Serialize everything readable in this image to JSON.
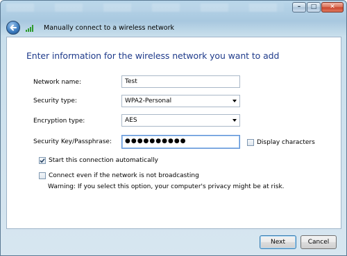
{
  "window": {
    "controls": {
      "minimize": "–",
      "maximize": "□",
      "close": "✕"
    }
  },
  "nav": {
    "title": "Manually connect to a wireless network",
    "back_icon": "back-arrow-icon",
    "network_icon": "wireless-signal-icon"
  },
  "form": {
    "heading": "Enter information for the wireless network you want to add",
    "network_name": {
      "label": "Network name:",
      "value": "Test"
    },
    "security_type": {
      "label": "Security type:",
      "value": "WPA2-Personal"
    },
    "encryption_type": {
      "label": "Encryption type:",
      "value": "AES"
    },
    "passphrase": {
      "label": "Security Key/Passphrase:",
      "value": "●●●●●●●●●●"
    },
    "display_characters": {
      "label": "Display characters",
      "checked": false
    },
    "start_automatically": {
      "label": "Start this connection automatically",
      "checked": true
    },
    "connect_hidden": {
      "label": "Connect even if the network is not broadcasting",
      "checked": false
    },
    "warning": "Warning: If you select this option, your computer's privacy might be at risk."
  },
  "footer": {
    "next": "Next",
    "cancel": "Cancel"
  },
  "colors": {
    "heading": "#1f3b8b",
    "accent": "#3c7fb1",
    "signal": "#2e9b2e"
  }
}
